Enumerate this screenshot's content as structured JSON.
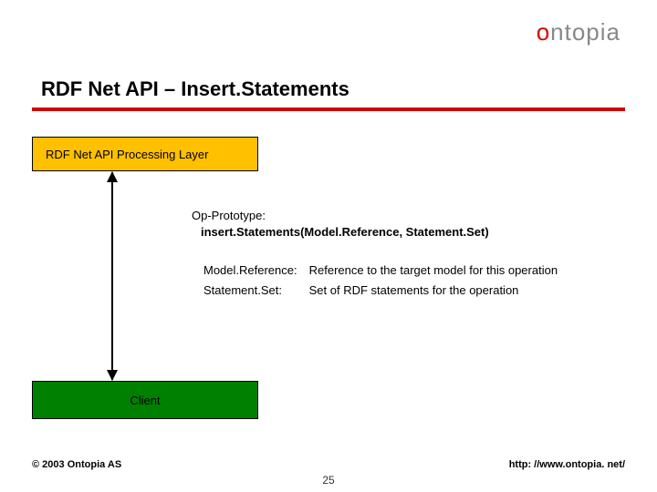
{
  "logo": {
    "accent": "o",
    "rest": "ntopia"
  },
  "title": "RDF Net API – Insert.Statements",
  "layer_box": "RDF Net API Processing Layer",
  "client_box": "Client",
  "op": {
    "label": "Op-Prototype:",
    "signature": "insert.Statements(Model.Reference, Statement.Set)"
  },
  "params": [
    {
      "name": "Model.Reference:",
      "desc": "Reference to the target model for this operation"
    },
    {
      "name": "Statement.Set:",
      "desc": "Set of RDF statements for the operation"
    }
  ],
  "footer": {
    "copyright": "© 2003 Ontopia AS",
    "url": "http: //www.ontopia. net/",
    "page": "25"
  }
}
